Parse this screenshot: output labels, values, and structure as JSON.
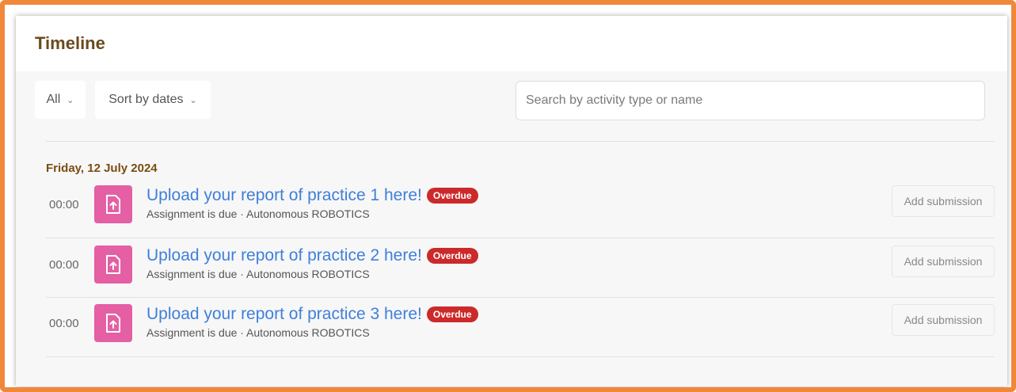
{
  "panel": {
    "title": "Timeline"
  },
  "filters": {
    "day_filter": "All",
    "sort": "Sort by dates",
    "search_placeholder": "Search by activity type or name"
  },
  "timeline": {
    "date_heading": "Friday, 12 July 2024",
    "events": [
      {
        "time": "00:00",
        "title": "Upload your report of practice 1 here!",
        "badge": "Overdue",
        "subtitle": "Assignment is due · Autonomous ROBOTICS",
        "action": "Add submission"
      },
      {
        "time": "00:00",
        "title": "Upload your report of practice 2 here!",
        "badge": "Overdue",
        "subtitle": "Assignment is due · Autonomous ROBOTICS",
        "action": "Add submission"
      },
      {
        "time": "00:00",
        "title": "Upload your report of practice 3 here!",
        "badge": "Overdue",
        "subtitle": "Assignment is due · Autonomous ROBOTICS",
        "action": "Add submission"
      }
    ]
  },
  "icons": {
    "chevron": "chevron-down-icon",
    "assignment": "upload-file-icon"
  },
  "colors": {
    "frame_border": "#f0883a",
    "title_brown": "#6b4a1f",
    "date_brown": "#7a4d12",
    "link_blue": "#3f7fdb",
    "icon_pink": "#e45fa4",
    "badge_red": "#cc2a2a"
  }
}
